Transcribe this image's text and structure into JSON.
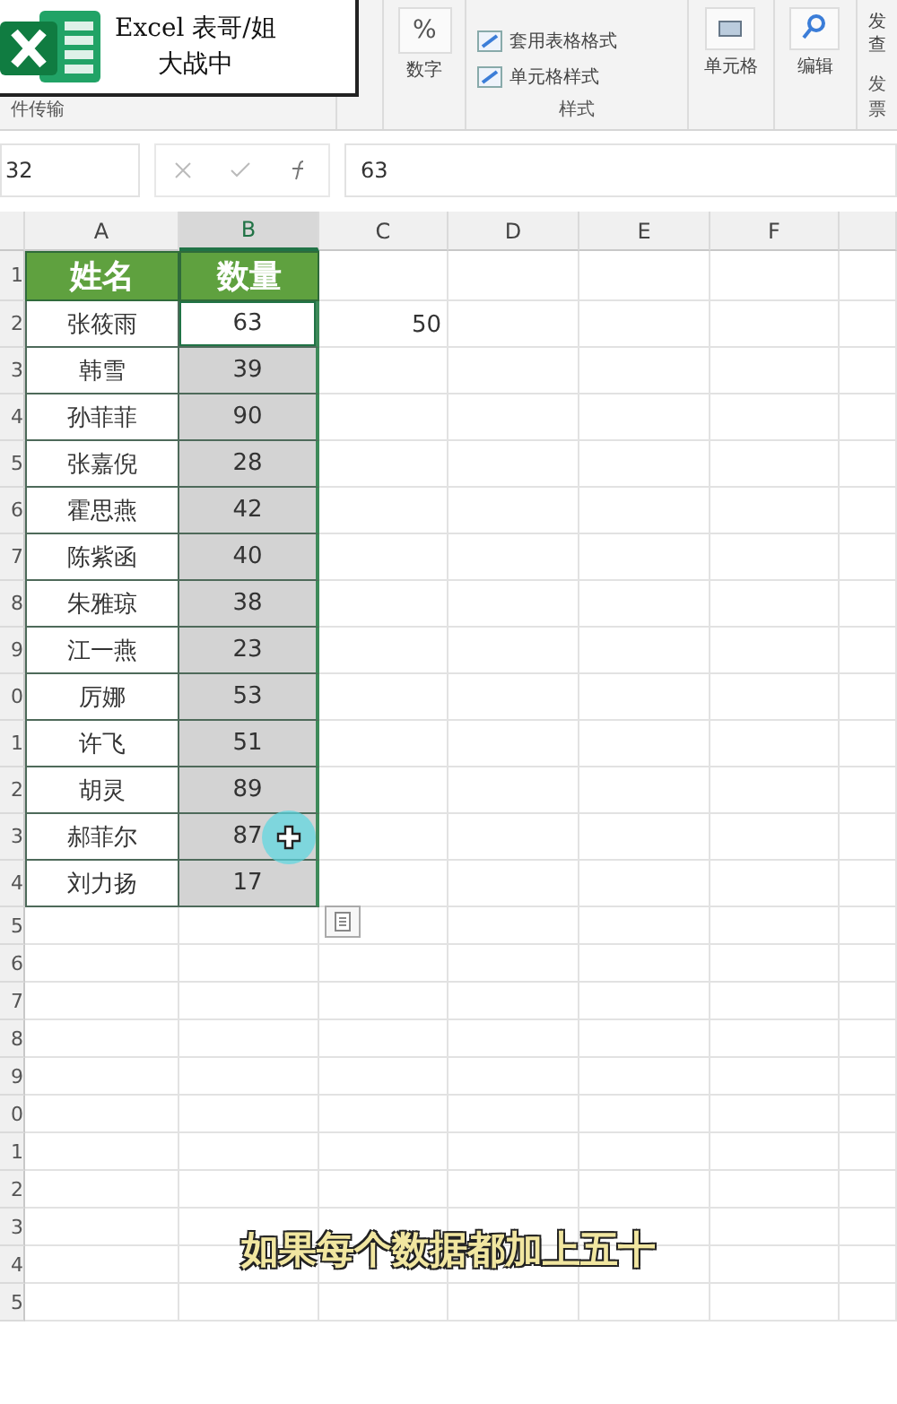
{
  "ribbon": {
    "badge": {
      "line_1": "Excel 表哥/姐",
      "line_2": "大战中"
    },
    "left_group": "件传输",
    "number": {
      "icon": "%",
      "label": "数字"
    },
    "styles": {
      "items": [
        "套用表格格式",
        "单元格样式"
      ],
      "label": "样式"
    },
    "cells": {
      "label": "单元格"
    },
    "edit": {
      "label": "编辑"
    },
    "invoice": {
      "lines": [
        "发",
        "查"
      ],
      "label": "发票"
    }
  },
  "formula_bar": {
    "name_box": "32",
    "value": "63"
  },
  "columns": [
    {
      "label": "A",
      "selected": false
    },
    {
      "label": "B",
      "selected": true
    },
    {
      "label": "C",
      "selected": false
    },
    {
      "label": "D",
      "selected": false
    },
    {
      "label": "E",
      "selected": false
    },
    {
      "label": "F",
      "selected": false
    }
  ],
  "rows": [
    {
      "number": "1",
      "kind": "header",
      "cells": [
        "姓名",
        "数量",
        ""
      ],
      "b_selected": false,
      "b_active": false
    },
    {
      "number": "2",
      "kind": "data",
      "cells": [
        "张筱雨",
        "63",
        "50"
      ],
      "b_selected": true,
      "b_active": true
    },
    {
      "number": "3",
      "kind": "data",
      "cells": [
        "韩雪",
        "39",
        ""
      ],
      "b_selected": true,
      "b_active": false
    },
    {
      "number": "4",
      "kind": "data",
      "cells": [
        "孙菲菲",
        "90",
        ""
      ],
      "b_selected": true,
      "b_active": false
    },
    {
      "number": "5",
      "kind": "data",
      "cells": [
        "张嘉倪",
        "28",
        ""
      ],
      "b_selected": true,
      "b_active": false
    },
    {
      "number": "6",
      "kind": "data",
      "cells": [
        "霍思燕",
        "42",
        ""
      ],
      "b_selected": true,
      "b_active": false
    },
    {
      "number": "7",
      "kind": "data",
      "cells": [
        "陈紫函",
        "40",
        ""
      ],
      "b_selected": true,
      "b_active": false
    },
    {
      "number": "8",
      "kind": "data",
      "cells": [
        "朱雅琼",
        "38",
        ""
      ],
      "b_selected": true,
      "b_active": false
    },
    {
      "number": "9",
      "kind": "data",
      "cells": [
        "江一燕",
        "23",
        ""
      ],
      "b_selected": true,
      "b_active": false
    },
    {
      "number": "0",
      "kind": "data",
      "cells": [
        "厉娜",
        "53",
        ""
      ],
      "b_selected": true,
      "b_active": false
    },
    {
      "number": "1",
      "kind": "data",
      "cells": [
        "许飞",
        "51",
        ""
      ],
      "b_selected": true,
      "b_active": false
    },
    {
      "number": "2",
      "kind": "data",
      "cells": [
        "胡灵",
        "89",
        ""
      ],
      "b_selected": true,
      "b_active": false
    },
    {
      "number": "3",
      "kind": "data",
      "cells": [
        "郝菲尔",
        "87",
        ""
      ],
      "b_selected": true,
      "b_active": false
    },
    {
      "number": "4",
      "kind": "data",
      "cells": [
        "刘力扬",
        "17",
        ""
      ],
      "b_selected": true,
      "b_active": false
    },
    {
      "number": "5",
      "kind": "empty",
      "cells": []
    },
    {
      "number": "6",
      "kind": "empty",
      "cells": []
    },
    {
      "number": "7",
      "kind": "empty",
      "cells": []
    },
    {
      "number": "8",
      "kind": "empty",
      "cells": []
    },
    {
      "number": "9",
      "kind": "empty",
      "cells": []
    },
    {
      "number": "0",
      "kind": "empty",
      "cells": []
    },
    {
      "number": "1",
      "kind": "empty",
      "cells": []
    },
    {
      "number": "2",
      "kind": "empty",
      "cells": []
    },
    {
      "number": "3",
      "kind": "empty",
      "cells": []
    },
    {
      "number": "4",
      "kind": "empty",
      "cells": []
    },
    {
      "number": "5",
      "kind": "empty",
      "cells": []
    }
  ],
  "caption": "如果每个数据都加上五十"
}
